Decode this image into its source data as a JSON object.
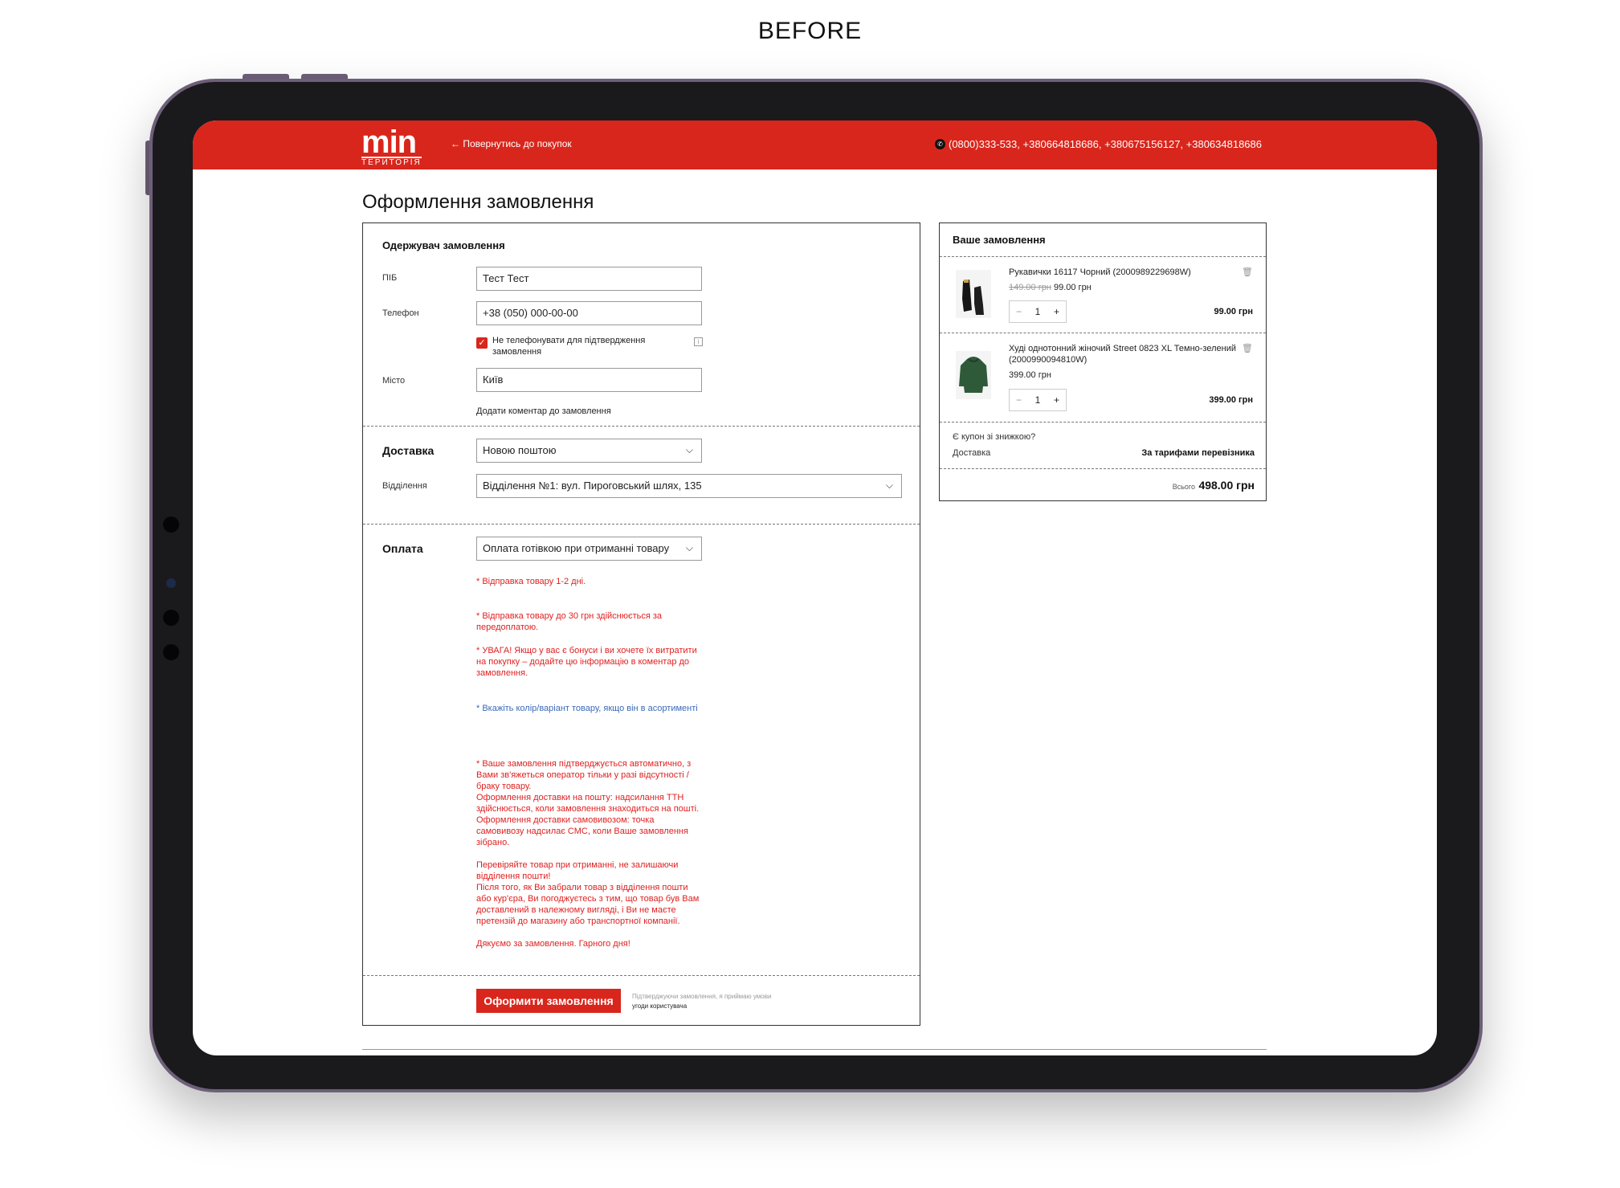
{
  "caption": "BEFORE",
  "header": {
    "logo_main": "min",
    "logo_sub": "ТЕРИТОРІЯ",
    "back_link": "Повернутись до покупок",
    "phones": "(0800)333-533,  +380664818686,  +380675156127,  +380634818686"
  },
  "page_title": "Оформлення замовлення",
  "recipient": {
    "title": "Одержувач замовлення",
    "name_label": "ПІБ",
    "name_value": "Тест Тест",
    "phone_label": "Телефон",
    "phone_value": "+38 (050) 000-00-00",
    "no_call_label": "Не телефонувати для підтвердження замовлення",
    "city_label": "Місто",
    "city_value": "Київ",
    "comment_link": "Додати коментар до замовлення"
  },
  "delivery": {
    "title": "Доставка",
    "method": "Новою поштою",
    "branch_label": "Відділення",
    "branch_value": "Відділення №1: вул. Пироговський шлях, 135"
  },
  "payment": {
    "title": "Оплата",
    "method": "Оплата готівкою при отриманні товару",
    "notes": [
      "* Відправка товару 1-2 дні.",
      "* Відправка товару до 30 грн здійснюється за передоплатою.",
      "* УВАГА! Якщо у вас є бонуси і ви хочете їх витратити на покупку – додайте цю інформацію в коментар до замовлення.",
      "* Вкажіть колір/варіант товару, якщо він в асортименті",
      "* Ваше замовлення підтверджується автоматично, з Вами зв'яжеться оператор тільки у разі відсутності / браку товару.\nОформлення доставки на пошту: надсилання ТТН здійснюється, коли замовлення знаходиться на пошті.\nОформлення доставки самовивозом: точка самовивозу надсилає СМС, коли Ваше замовлення зібрано.\n\nПеревіряйте товар при отриманні, не залишаючи відділення пошти!\nПісля того, як Ви забрали товар з відділення пошти або кур'єра, Ви погоджуєтесь з тим, що товар був Вам доставлений в належному вигляді, і Ви не маєте претензій до магазину або транспортної компанії.\n\nДякуємо за замовлення. Гарного дня!"
    ]
  },
  "submit": {
    "button": "Оформити замовлення",
    "terms_prefix": "Підтверджуючи замовлення, я приймаю умови",
    "terms_link": "угоди користувача"
  },
  "order": {
    "title": "Ваше замовлення",
    "items": [
      {
        "name": "Рукавички 16117 Чорний (2000989229698W)",
        "old_price": "149.00 грн",
        "price": "99.00 грн",
        "qty": "1",
        "total": "99.00 грн"
      },
      {
        "name": "Худі однотонний жіночий Street 0823 XL Темно-зелений (2000990094810W)",
        "old_price": "",
        "price": "399.00 грн",
        "qty": "1",
        "total": "399.00 грн"
      }
    ],
    "coupon": "Є купон зі знижкою?",
    "delivery_label": "Доставка",
    "delivery_value": "За тарифами перевізника",
    "total_label": "Всього",
    "total_value": "498.00 грн"
  },
  "colors": {
    "brand_red": "#d9261c",
    "note_red": "#e02020",
    "note_blue": "#3a6ab8"
  }
}
